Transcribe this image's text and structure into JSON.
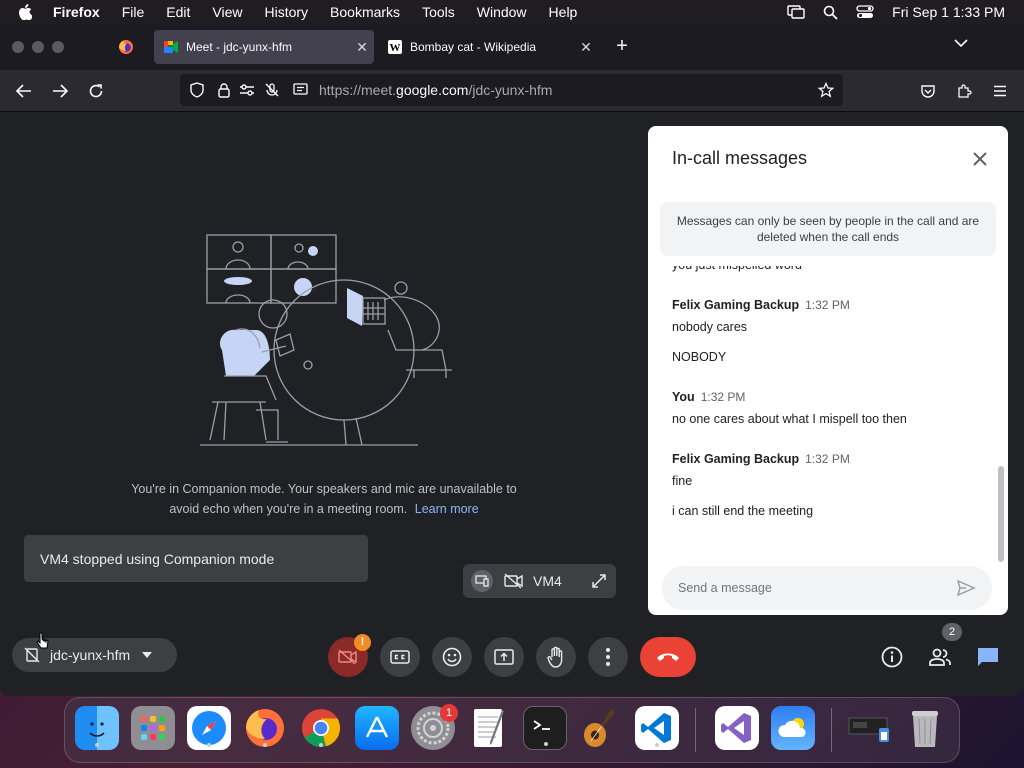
{
  "menubar": {
    "app": "Firefox",
    "items": [
      "File",
      "Edit",
      "View",
      "History",
      "Bookmarks",
      "Tools",
      "Window",
      "Help"
    ],
    "clock": "Fri Sep 1  1:33 PM"
  },
  "tabs": [
    {
      "title": "Meet - jdc-yunx-hfm",
      "icon": "google-meet-icon",
      "active": true
    },
    {
      "title": "Bombay cat - Wikipedia",
      "icon": "wikipedia-icon",
      "active": false
    }
  ],
  "urlbar": {
    "prefix": "https://meet.",
    "domain": "google.com",
    "path": "/jdc-yunx-hfm"
  },
  "meet": {
    "companion_text": "You're in Companion mode. Your speakers and mic are unavailable to avoid echo when you're in a meeting room.",
    "learn_more": "Learn more",
    "toast": "VM4 stopped using Companion mode",
    "mini_label": "VM4",
    "meeting_code": "jdc-yunx-hfm",
    "participants_count": "2",
    "alert_badge": "!"
  },
  "panel": {
    "title": "In-call messages",
    "notice": "Messages can only be seen by people in the call and are deleted when the call ends",
    "partial_line": "you just mispelled  word",
    "messages": [
      {
        "sender": "Felix Gaming Backup",
        "time": "1:32 PM",
        "lines": [
          "nobody cares",
          "NOBODY"
        ]
      },
      {
        "sender": "You",
        "time": "1:32 PM",
        "lines": [
          "no one cares about what I mispell too then"
        ]
      },
      {
        "sender": "Felix Gaming Backup",
        "time": "1:32 PM",
        "lines": [
          "fine",
          "i can still end the meeting"
        ]
      }
    ],
    "input_placeholder": "Send a message"
  },
  "dock": {
    "apps": [
      "Finder",
      "Launchpad",
      "Safari",
      "Firefox",
      "Chrome",
      "App Store",
      "System Settings",
      "TextEdit",
      "Terminal",
      "Instruments",
      "Visual Studio Code",
      "Visual Studio",
      "Weather",
      "Downloads",
      "Trash"
    ],
    "settings_badge": "1"
  },
  "colors": {
    "accent": "#8ab4f8",
    "end_call": "#ea4335",
    "meet_bg": "#202124"
  }
}
